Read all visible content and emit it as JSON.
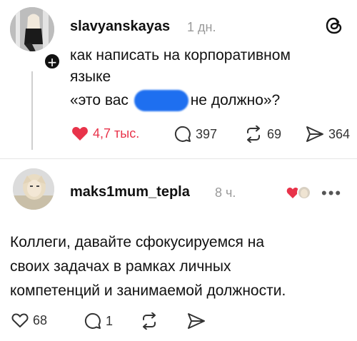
{
  "post1": {
    "username": "slavyanskayas",
    "time": "1 дн.",
    "text_line1": "как написать на корпоративном",
    "text_line2": "языке",
    "text_line3_start": "«это вас",
    "text_line3_end": "ь не должно»?",
    "likes": "4,7 тыс.",
    "comments": "397",
    "reposts": "69",
    "shares": "364"
  },
  "post2": {
    "username": "maks1mum_tepla",
    "time": "8 ч.",
    "text_line1": "Коллеги, давайте сфокусируемся на",
    "text_line2": "своих задачах в рамках личных",
    "text_line3": "компетенций и занимаемой должности.",
    "likes": "68",
    "comments": "1"
  },
  "colors": {
    "like_red": "#e8334a",
    "redaction_blue": "#1e6ff0",
    "muted_gray": "#9a9a9a"
  },
  "icons": {
    "threads": "threads-logo-icon",
    "heart_filled": "heart-filled-icon",
    "heart_outline": "heart-outline-icon",
    "comment": "comment-bubble-icon",
    "repost": "repost-icon",
    "share": "share-send-icon",
    "more": "more-options-icon"
  }
}
